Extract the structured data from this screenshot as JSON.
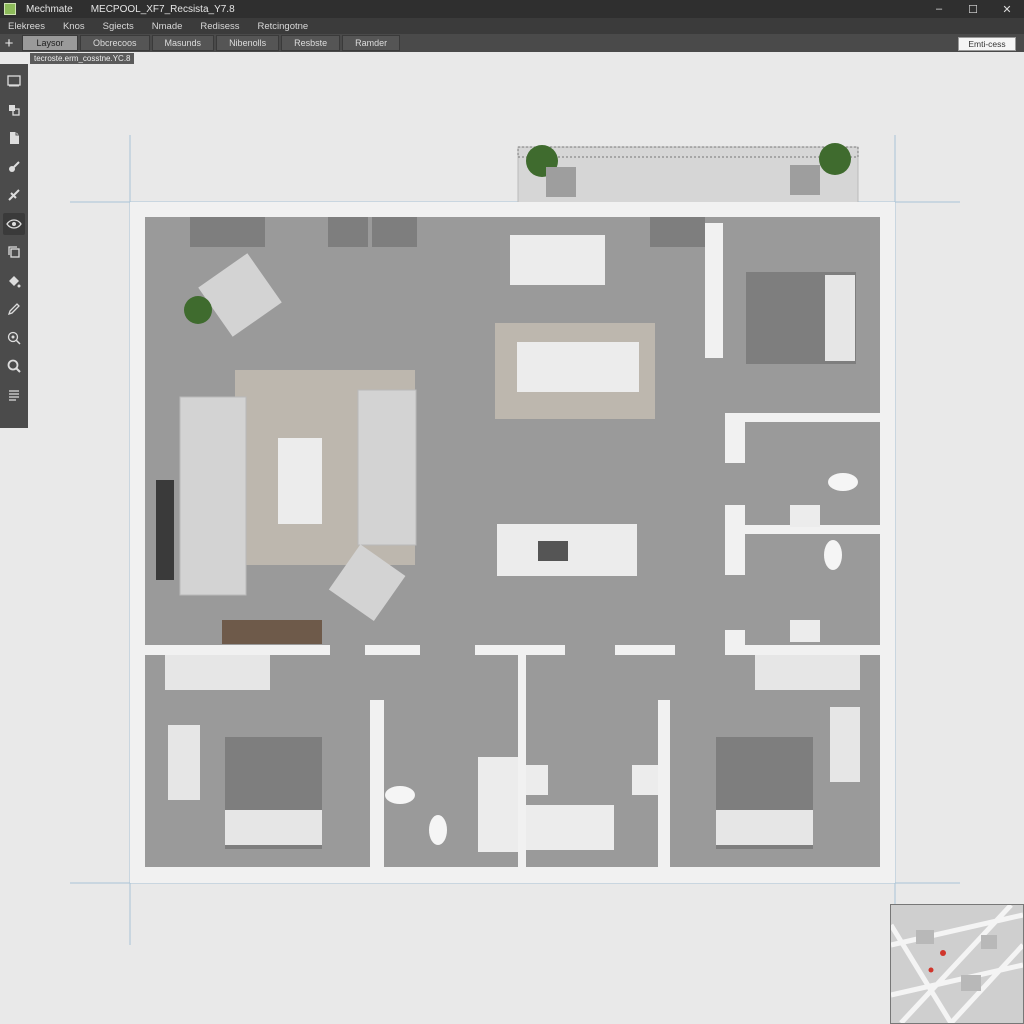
{
  "window": {
    "app_name": "Mechmate",
    "doc_title": "MECPOOL_XF7_Recsista_Y7.8",
    "minimize_glyph": "–",
    "maximize_glyph": "☐",
    "close_glyph": "✕"
  },
  "menu": [
    "Elekrees",
    "Knos",
    "Sgiects",
    "Nmade",
    "Redisess",
    "Retcingotne"
  ],
  "tabs": {
    "add_glyph": "+",
    "items": [
      {
        "label": "Laysor",
        "active": true
      },
      {
        "label": "Obcrecoos",
        "active": false
      },
      {
        "label": "Masunds",
        "active": false
      },
      {
        "label": "Nibenolls",
        "active": false
      },
      {
        "label": "Resbste",
        "active": false
      },
      {
        "label": "Ramder",
        "active": false
      }
    ]
  },
  "search": {
    "value": "Emti-cess"
  },
  "hint_text": "tecroste.erm_cosstne.YC.8",
  "tools": [
    {
      "icon": "select-box-icon",
      "active": false
    },
    {
      "icon": "layers-icon",
      "active": false
    },
    {
      "icon": "document-icon",
      "active": false
    },
    {
      "icon": "paint-icon",
      "active": false
    },
    {
      "icon": "move-icon",
      "active": false
    },
    {
      "icon": "eye-icon",
      "active": true
    },
    {
      "icon": "copy-icon",
      "active": false
    },
    {
      "icon": "fill-icon",
      "active": false
    },
    {
      "icon": "pencil-icon",
      "active": false
    },
    {
      "icon": "zoom-target-icon",
      "active": false
    },
    {
      "icon": "search-icon",
      "active": false
    },
    {
      "icon": "list-icon",
      "active": false
    }
  ],
  "colors": {
    "floor": "#9a9a9a",
    "wall": "#f1f1f1",
    "rug": "#bdb7ae",
    "furniture": "#d3d3d3",
    "bedding": "#7e7e7e",
    "wood": "#6e5a4a",
    "plant": "#3f6b2e",
    "guide": "#a9c4d6"
  }
}
